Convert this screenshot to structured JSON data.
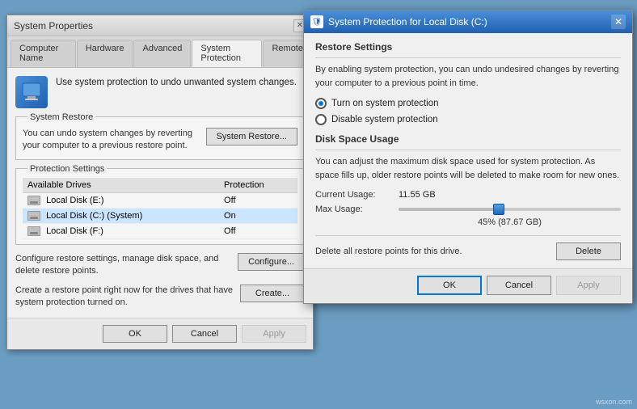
{
  "systemProps": {
    "title": "System Properties",
    "tabs": [
      {
        "label": "Computer Name",
        "active": false
      },
      {
        "label": "Hardware",
        "active": false
      },
      {
        "label": "Advanced",
        "active": false
      },
      {
        "label": "System Protection",
        "active": true
      },
      {
        "label": "Remote",
        "active": false
      }
    ],
    "icon_label": "🖥",
    "restore_intro": "Use system protection to undo unwanted system changes.",
    "groups": {
      "system_restore": {
        "title": "System Restore",
        "description": "You can undo system changes by reverting your computer to a previous restore point.",
        "button": "System Restore..."
      },
      "protection_settings": {
        "title": "Protection Settings",
        "columns": [
          "Available Drives",
          "Protection"
        ],
        "drives": [
          {
            "name": "Local Disk (E:)",
            "protection": "Off",
            "selected": false
          },
          {
            "name": "Local Disk (C:) (System)",
            "protection": "On",
            "selected": true
          },
          {
            "name": "Local Disk (F:)",
            "protection": "Off",
            "selected": false
          }
        ]
      },
      "configure": {
        "description": "Configure restore settings, manage disk space, and delete restore points.",
        "button": "Configure..."
      },
      "create": {
        "description": "Create a restore point right now for the drives that have system protection turned on.",
        "button": "Create..."
      }
    },
    "bottomBtns": [
      "OK",
      "Cancel",
      "Apply"
    ]
  },
  "dialog": {
    "title": "System Protection for Local Disk (C:)",
    "icon": "🛡",
    "sections": {
      "restore_settings": {
        "title": "Restore Settings",
        "description": "By enabling system protection, you can undo undesired changes by reverting your computer to a previous point in time.",
        "options": [
          {
            "label": "Turn on system protection",
            "checked": true
          },
          {
            "label": "Disable system protection",
            "checked": false
          }
        ]
      },
      "disk_space": {
        "title": "Disk Space Usage",
        "description": "You can adjust the maximum disk space used for system protection. As space fills up, older restore points will be deleted to make room for new ones.",
        "current_usage_label": "Current Usage:",
        "current_usage_value": "11.55 GB",
        "max_usage_label": "Max Usage:",
        "slider_pct": "45% (87.67 GB)",
        "slider_value": 45
      },
      "delete": {
        "text": "Delete all restore points for this drive.",
        "button": "Delete"
      }
    },
    "bottomBtns": [
      "OK",
      "Cancel",
      "Apply"
    ]
  },
  "watermark": "wsxon.com"
}
